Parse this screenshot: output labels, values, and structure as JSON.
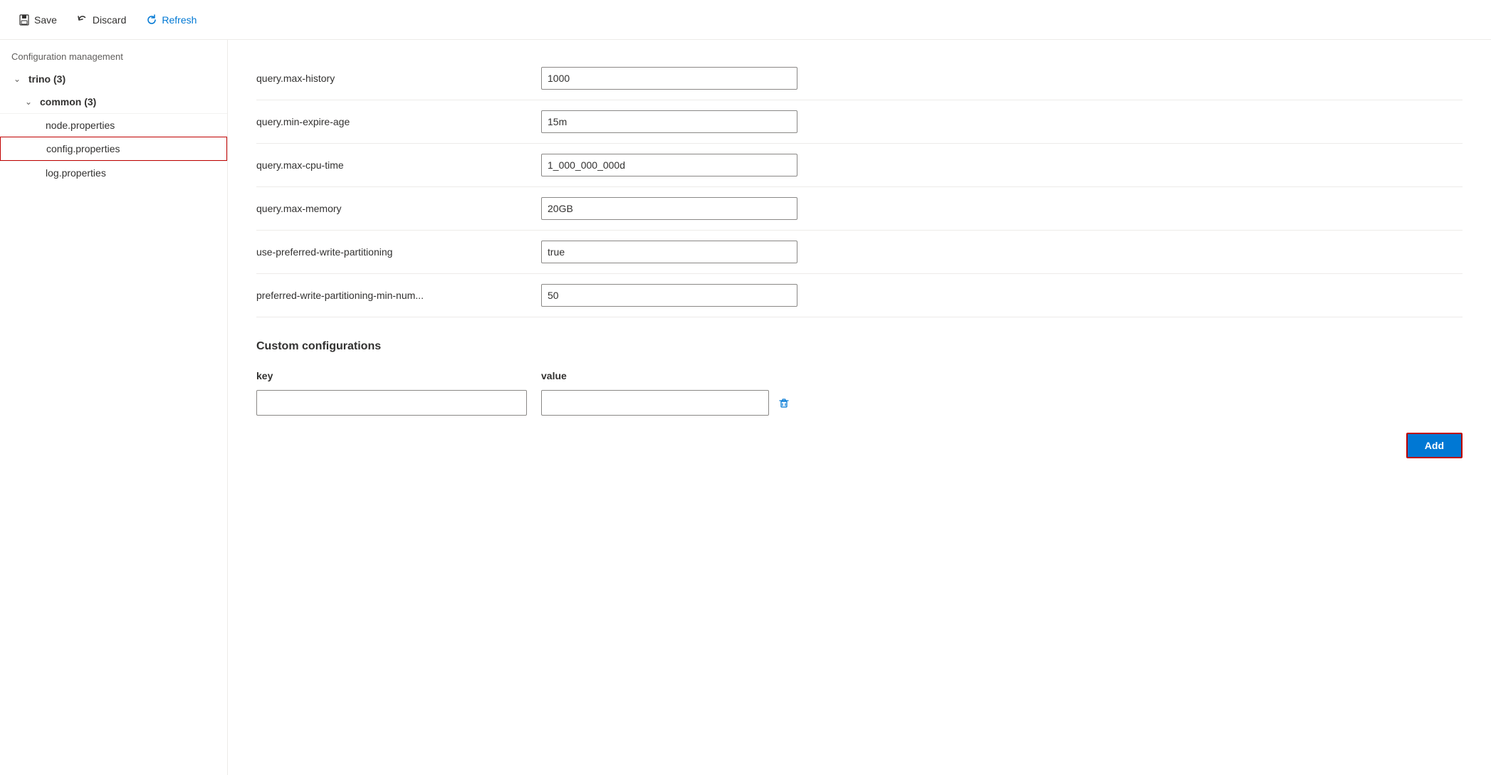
{
  "toolbar": {
    "save_label": "Save",
    "discard_label": "Discard",
    "refresh_label": "Refresh"
  },
  "sidebar": {
    "section_title": "Configuration management",
    "tree": {
      "root_label": "trino (3)",
      "root_count": "3",
      "child_label": "common (3)",
      "child_count": "3",
      "items": [
        {
          "label": "node.properties"
        },
        {
          "label": "config.properties",
          "selected": true
        },
        {
          "label": "log.properties"
        }
      ]
    }
  },
  "config_rows": [
    {
      "key": "query.max-history",
      "value": "1000"
    },
    {
      "key": "query.min-expire-age",
      "value": "15m"
    },
    {
      "key": "query.max-cpu-time",
      "value": "1_000_000_000d"
    },
    {
      "key": "query.max-memory",
      "value": "20GB"
    },
    {
      "key": "use-preferred-write-partitioning",
      "value": "true"
    },
    {
      "key": "preferred-write-partitioning-min-num...",
      "value": "50"
    }
  ],
  "custom_config": {
    "title": "Custom configurations",
    "col_key": "key",
    "col_value": "value",
    "rows": [
      {
        "key": "",
        "value": ""
      }
    ]
  },
  "add_button_label": "Add"
}
